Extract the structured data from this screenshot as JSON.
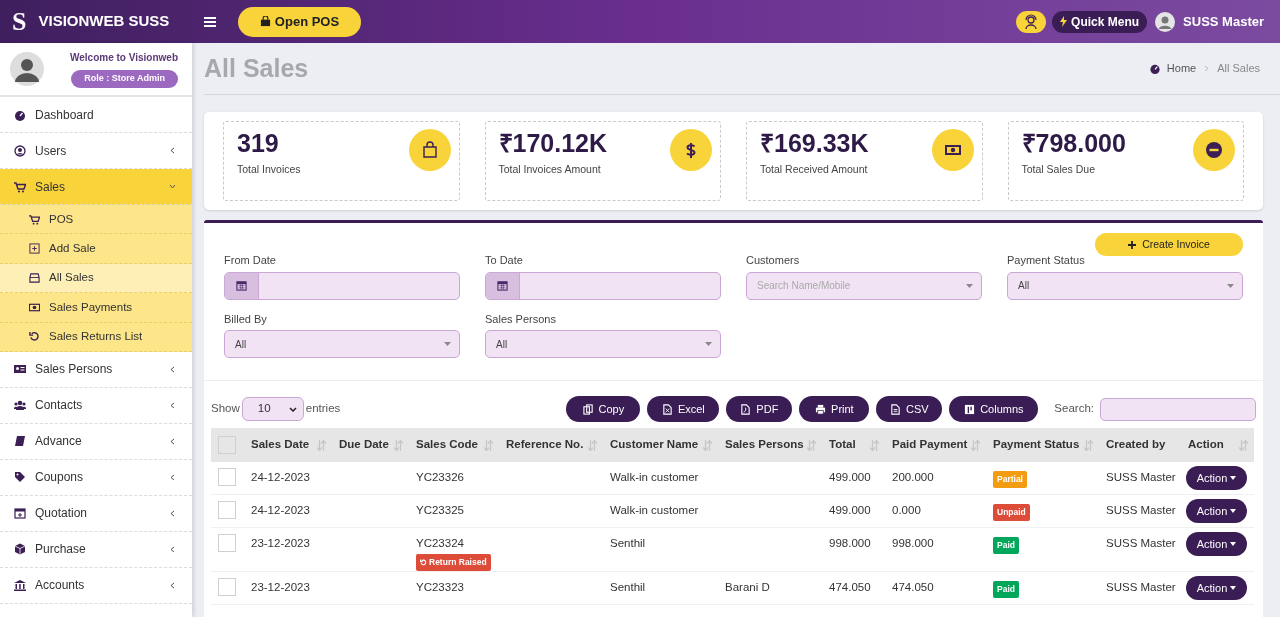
{
  "header": {
    "logo_letter": "S",
    "brand": "VISIONWEB SUSS",
    "open_pos": "Open POS",
    "quick_menu": "Quick Menu",
    "user": "SUSS Master"
  },
  "profile": {
    "welcome": "Welcome to Visionweb",
    "role": "Role : Store Admin"
  },
  "sidebar": {
    "items": [
      {
        "label": "Dashboard",
        "selected": false
      },
      {
        "label": "Users",
        "selected": false,
        "expanded": false
      },
      {
        "label": "Sales",
        "selected": true,
        "expanded": true,
        "children": [
          {
            "label": "POS",
            "selected": false
          },
          {
            "label": "Add Sale",
            "selected": false
          },
          {
            "label": "All Sales",
            "selected": true
          },
          {
            "label": "Sales Payments",
            "selected": false
          },
          {
            "label": "Sales Returns List",
            "selected": false
          }
        ]
      },
      {
        "label": "Sales Persons",
        "selected": false,
        "expanded": false
      },
      {
        "label": "Contacts",
        "selected": false,
        "expanded": false
      },
      {
        "label": "Advance",
        "selected": false,
        "expanded": false
      },
      {
        "label": "Coupons",
        "selected": false,
        "expanded": false
      },
      {
        "label": "Quotation",
        "selected": false,
        "expanded": false
      },
      {
        "label": "Purchase",
        "selected": false,
        "expanded": false
      },
      {
        "label": "Accounts",
        "selected": false,
        "expanded": false
      }
    ]
  },
  "page": {
    "title": "All Sales",
    "breadcrumb": [
      "Home",
      "All Sales"
    ]
  },
  "stats": [
    {
      "value": "319",
      "label": "Total Invoices"
    },
    {
      "value": "₹170.12K",
      "label": "Total Invoices Amount"
    },
    {
      "value": "₹169.33K",
      "label": "Total Received Amount"
    },
    {
      "value": "₹798.000",
      "label": "Total Sales Due"
    }
  ],
  "filters": {
    "create_invoice": "Create Invoice",
    "fields": [
      {
        "label": "From Date",
        "kind": "date"
      },
      {
        "label": "To Date",
        "kind": "date"
      },
      {
        "label": "Customers",
        "kind": "select",
        "placeholder": "Search Name/Mobile"
      },
      {
        "label": "Payment Status",
        "kind": "select",
        "value": "All"
      },
      {
        "label": "Billed By",
        "kind": "select",
        "value": "All"
      },
      {
        "label": "Sales Persons",
        "kind": "select",
        "value": "All"
      }
    ]
  },
  "table_controls": {
    "show": "Show",
    "page_size": "10",
    "entries": "entries",
    "buttons": [
      "Copy",
      "Excel",
      "PDF",
      "Print",
      "CSV",
      "Columns"
    ],
    "search": "Search:"
  },
  "table": {
    "select_all_checked": false,
    "columns": [
      {
        "label": "Sales Date",
        "sortable": true
      },
      {
        "label": "Due Date",
        "sortable": true
      },
      {
        "label": "Sales Code",
        "sortable": true
      },
      {
        "label": "Reference No.",
        "sortable": true
      },
      {
        "label": "Customer Name",
        "sortable": true
      },
      {
        "label": "Sales Persons",
        "sortable": true
      },
      {
        "label": "Total",
        "sortable": true
      },
      {
        "label": "Paid Payment",
        "sortable": true
      },
      {
        "label": "Payment Status",
        "sortable": true
      },
      {
        "label": "Created by",
        "sortable": false
      },
      {
        "label": "Action",
        "sortable": true
      }
    ],
    "rows": [
      {
        "checked": false,
        "sales_date": "24-12-2023",
        "sales_code": "YC23326",
        "customer": "Walk-in customer",
        "total": "499.000",
        "paid": "200.000",
        "status": {
          "label": "Partial",
          "color": "#f39c12"
        },
        "created_by": "SUSS Master",
        "action": "Action"
      },
      {
        "checked": false,
        "sales_date": "24-12-2023",
        "sales_code": "YC23325",
        "customer": "Walk-in customer",
        "total": "499.000",
        "paid": "0.000",
        "status": {
          "label": "Unpaid",
          "color": "#dd4b39"
        },
        "created_by": "SUSS Master",
        "action": "Action"
      },
      {
        "checked": false,
        "sales_date": "23-12-2023",
        "sales_code": "YC23324",
        "return_badge": "Return Raised",
        "customer": "Senthil",
        "total": "998.000",
        "paid": "998.000",
        "status": {
          "label": "Paid",
          "color": "#00a65a"
        },
        "created_by": "SUSS Master",
        "action": "Action"
      },
      {
        "checked": false,
        "sales_date": "23-12-2023",
        "sales_code": "YC23323",
        "customer": "Senthil",
        "sales_person": "Barani D",
        "total": "474.050",
        "paid": "474.050",
        "status": {
          "label": "Paid",
          "color": "#00a65a"
        },
        "created_by": "SUSS Master",
        "action": "Action"
      }
    ]
  }
}
